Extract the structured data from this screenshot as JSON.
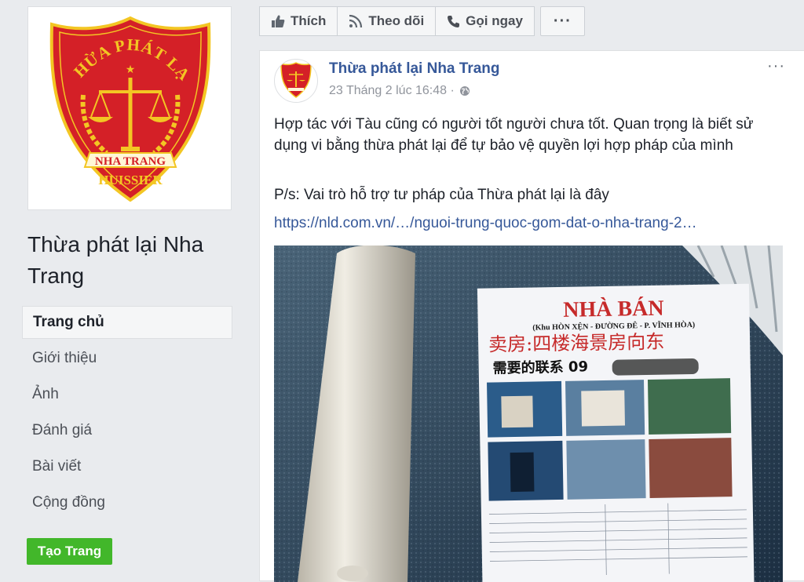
{
  "page": {
    "name": "Thừa phát lại Nha Trang",
    "logo_text_top": "THỪA PHÁT LẠI",
    "logo_text_ribbon": "NHA TRANG",
    "logo_text_bottom": "HUISSIER"
  },
  "sidebar": {
    "items": [
      {
        "label": "Trang chủ",
        "active": true
      },
      {
        "label": "Giới thiệu"
      },
      {
        "label": "Ảnh"
      },
      {
        "label": "Đánh giá"
      },
      {
        "label": "Bài viết"
      },
      {
        "label": "Cộng đồng"
      }
    ],
    "create_page_label": "Tạo Trang"
  },
  "actionbar": {
    "like_label": "Thích",
    "follow_label": "Theo dõi",
    "call_label": "Gọi ngay",
    "more_label": "···"
  },
  "post": {
    "author": "Thừa phát lại Nha Trang",
    "timestamp": "23 Tháng 2 lúc 16:48 ·",
    "menu_label": "···",
    "text1": "Hợp tác với Tàu cũng có người tốt người chưa tốt. Quan trọng là biết sử dụng vi bằng thừa phát lại để tự bảo vệ quyền lợi hợp pháp của mình",
    "text2": "P/s: Vai trò hỗ trợ tư pháp của Thừa phát lại là đây",
    "link": "https://nld.com.vn/…/nguoi-trung-quoc-gom-dat-o-nha-trang-2…",
    "photo": {
      "flyer_title": "NHÀ BÁN",
      "flyer_subtitle": "(Khu HÒN XỆN - ĐƯỜNG ĐÊ - P. VĨNH HÒA)",
      "flyer_chinese": "卖房:四楼海景房向东",
      "flyer_contact": "需要的联系 09"
    }
  },
  "colors": {
    "link": "#365899",
    "create_button": "#42b72a",
    "logo_red": "#d42027",
    "logo_gold": "#f3c623"
  }
}
